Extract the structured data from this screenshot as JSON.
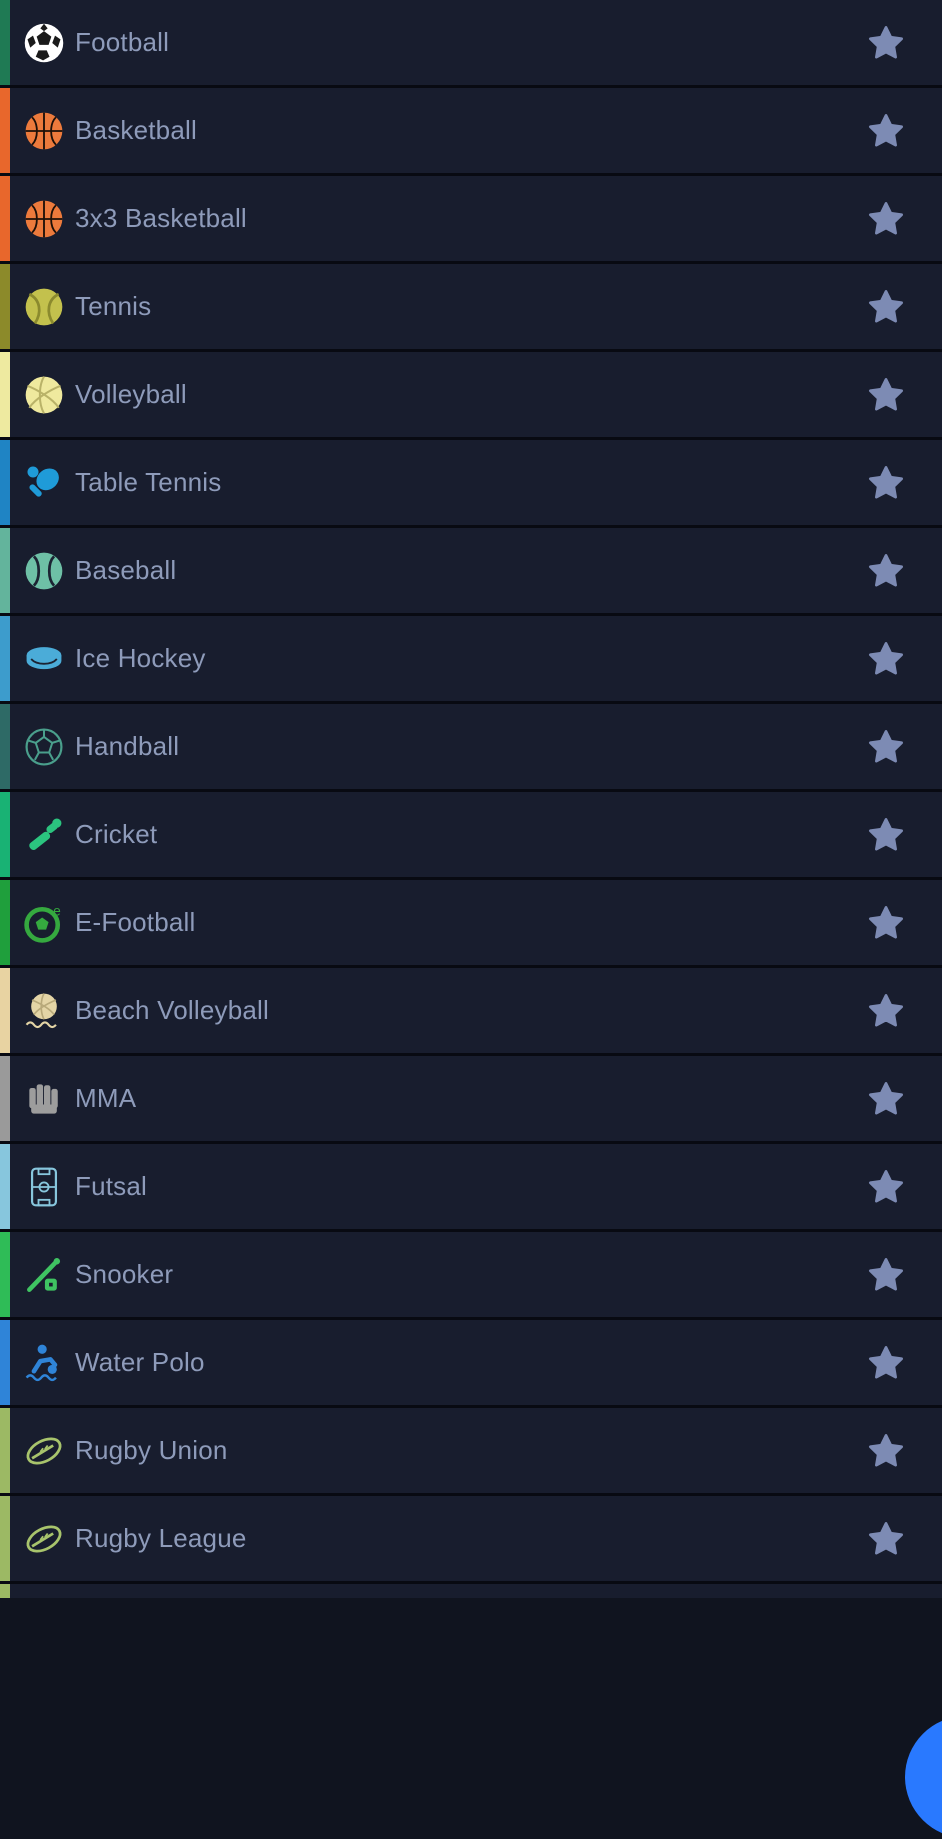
{
  "screen": {
    "name": "sports-list",
    "background_color": "#10141f",
    "row_background_color": "#181d2e",
    "row_divider_color": "#080a12",
    "label_color": "#8e9bba",
    "star_color": "#7d8bb4"
  },
  "fab": {
    "name": "floating-action-button",
    "color": "#2979ff",
    "visible": true,
    "label": ""
  },
  "star": {
    "icon": "star-icon",
    "state": "unselected",
    "color": "#7d8bb4"
  },
  "sports": [
    {
      "label": "Football",
      "icon": "soccer-ball-icon",
      "accent": "#1f7a54",
      "icon_color": "#ffffff"
    },
    {
      "label": "Basketball",
      "icon": "basketball-icon",
      "accent": "#e8672c",
      "icon_color": "#ec7a3c"
    },
    {
      "label": "3x3 Basketball",
      "icon": "basketball-icon",
      "accent": "#e8672c",
      "icon_color": "#ec7a3c"
    },
    {
      "label": "Tennis",
      "icon": "tennis-ball-icon",
      "accent": "#8c8a2a",
      "icon_color": "#c3c14d"
    },
    {
      "label": "Volleyball",
      "icon": "volleyball-icon",
      "accent": "#eeeaa0",
      "icon_color": "#efe99e"
    },
    {
      "label": "Table Tennis",
      "icon": "table-tennis-paddle-icon",
      "accent": "#1f84c4",
      "icon_color": "#1f9bd8"
    },
    {
      "label": "Baseball",
      "icon": "baseball-icon",
      "accent": "#63b49c",
      "icon_color": "#6ec0a6"
    },
    {
      "label": "Ice Hockey",
      "icon": "hockey-puck-icon",
      "accent": "#3d9ccc",
      "icon_color": "#4bacd8"
    },
    {
      "label": "Handball",
      "icon": "handball-icon",
      "accent": "#2e6a66",
      "icon_color": "#4a9f8c"
    },
    {
      "label": "Cricket",
      "icon": "cricket-bat-icon",
      "accent": "#19b274",
      "icon_color": "#2bc47f"
    },
    {
      "label": "E-Football",
      "icon": "e-football-icon",
      "accent": "#1f9f3c",
      "icon_color": "#35a93f"
    },
    {
      "label": "Beach Volleyball",
      "icon": "beach-volleyball-icon",
      "accent": "#e8d3a2",
      "icon_color": "#e4d5a6"
    },
    {
      "label": "MMA",
      "icon": "fist-icon",
      "accent": "#9a9a9a",
      "icon_color": "#9d9d9d"
    },
    {
      "label": "Futsal",
      "icon": "futsal-court-icon",
      "accent": "#87c6dd",
      "icon_color": "#87c6dd"
    },
    {
      "label": "Snooker",
      "icon": "snooker-cue-icon",
      "accent": "#2fbc57",
      "icon_color": "#3fc462"
    },
    {
      "label": "Water Polo",
      "icon": "water-polo-icon",
      "accent": "#2f84d8",
      "icon_color": "#2f84d8"
    },
    {
      "label": "Rugby Union",
      "icon": "rugby-ball-icon",
      "accent": "#9cb964",
      "icon_color": "#a8c46c"
    },
    {
      "label": "Rugby League",
      "icon": "rugby-ball-icon",
      "accent": "#9cb964",
      "icon_color": "#a8c46c"
    }
  ]
}
